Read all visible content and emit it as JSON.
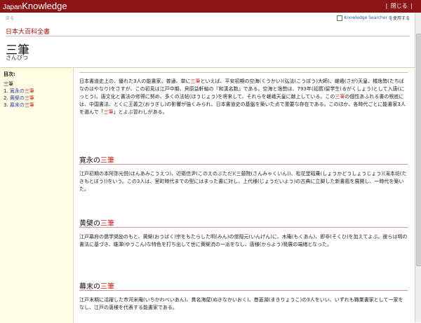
{
  "topbar": {
    "logo_small": "Japan",
    "logo_big": "Knowledge",
    "close_label": "閉じる"
  },
  "header": {
    "crumb": "戻る",
    "searcher_link": "Knowledge Searcher",
    "searcher_suffix": "を使用する",
    "encyclopedia": "日本大百科全書",
    "title": "三筆",
    "reading": "さんぴつ"
  },
  "toc": {
    "heading": "目次:",
    "root": "三筆",
    "items": [
      {
        "num": "1.",
        "prefix": "寛永の",
        "suffix": "三筆"
      },
      {
        "num": "2.",
        "prefix": "黄檗の",
        "suffix": "三筆"
      },
      {
        "num": "3.",
        "prefix": "幕末の",
        "suffix": "三筆"
      }
    ]
  },
  "content": {
    "intro": {
      "a": "日本書道史上の、優れた3人の能書家。普通、単に",
      "hl1": "三筆",
      "b": "といえば、平安初期の空海(くうかい)(弘法(こうぼう)大師)、嵯峨(さが)天皇、橘逸勢(たちばなのはやなり)をさすが、この初見は江戸中期、貝原益軒編の『和漢名数』である。空海と逸勢は、793年(延暦)留学生(るがくしょう)として入唐(にっとう)。唐文化と書法の修得に努め、多くの法帖(ほうじょう)を将来して、それらを嵯峨天皇に献上している。この",
      "hl2": "三筆",
      "c": "の個性あふれる書の根底には、中国書法、とくに王義之(おうぎし)の影響が強くみられ、日本書道史の基盤を築いた点で重要な存在である。このほか、各時代ごとに能書家3人を選んで「",
      "hl3": "三筆",
      "d": "」とよぶ習わしがある。"
    },
    "sections": [
      {
        "prefix": "寛永の",
        "suffix": "三筆",
        "body": "江戸初期の本阿弥光悦(ほんあみこうえつ)、近衛信尹(このえのぶただ)(三藐院(さんみゃくいん))、松花堂昭乗(しょうかどうしょうじょう)(滝本坊(たきもとぼう))をいう。この3人は、室町時代までの型にはまった書に対し、上代様(じょうだいよう)の古典に立脚した新書風を展開し、一時代を築いた。"
      },
      {
        "prefix": "黄檗の",
        "suffix": "三筆",
        "body": "江戸幕府の儒学奨励のもと、黄檗(おうばく)宗をもたらした明(みん)の僧隠元(いんげん)に、木庵(もくあん)、即非(そくひ)を加えてよぶ。彼らは明の書法に基づき、雄渾(ゆうこん)な特色を打ち出して世に黄檗流の一派をなし、唐様(からよう)発展の端緒となった。"
      },
      {
        "prefix": "幕末の",
        "suffix": "三筆",
        "body": "江戸末期に活躍した市河米庵(いちかわべいあん)、貫名海屋(ぬきなかいおく)、巻菱湖(まきりょうこ)の3人をいい、いずれも職業書家として一家をなし、江戸の唐様を代表する能書家である。"
      }
    ]
  }
}
